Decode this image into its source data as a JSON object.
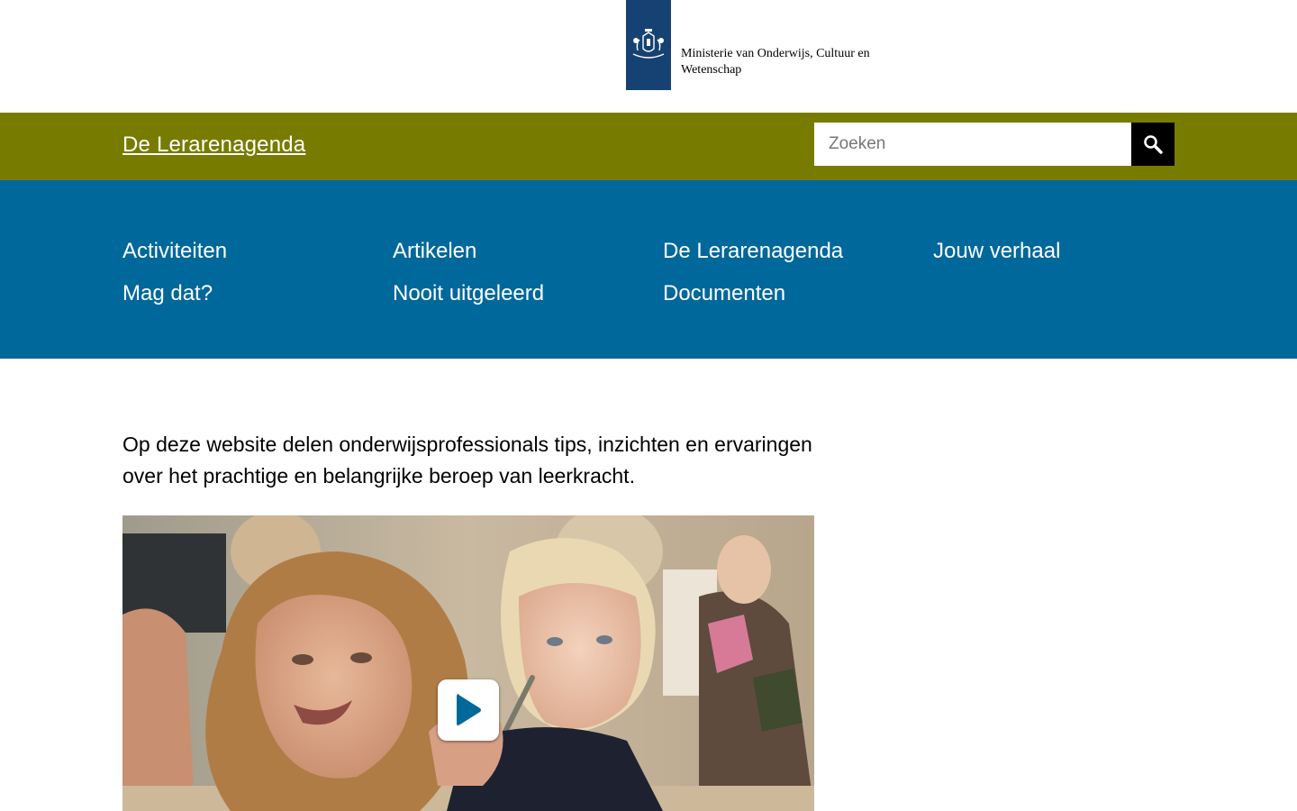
{
  "logo": {
    "ministry_name": "Ministerie van Onderwijs, Cultuur en Wetenschap",
    "ribbon_color": "#154273"
  },
  "header": {
    "site_title": "De Lerarenagenda",
    "background_color": "#777c00",
    "search": {
      "placeholder": "Zoeken",
      "value": "",
      "button_icon": "search-icon"
    }
  },
  "nav": {
    "background_color": "#01689b",
    "items": [
      {
        "label": "Activiteiten"
      },
      {
        "label": "Artikelen"
      },
      {
        "label": "De Lerarenagenda"
      },
      {
        "label": "Jouw verhaal"
      },
      {
        "label": "Mag dat?"
      },
      {
        "label": "Nooit uitgeleerd"
      },
      {
        "label": "Documenten"
      }
    ]
  },
  "main": {
    "intro": "Op deze website delen onderwijsprofessionals tips, inzichten en ervaringen over het prachtige en belangrijke beroep van leerkracht.",
    "video": {
      "play_icon": "play-icon",
      "play_color": "#01689b"
    }
  }
}
